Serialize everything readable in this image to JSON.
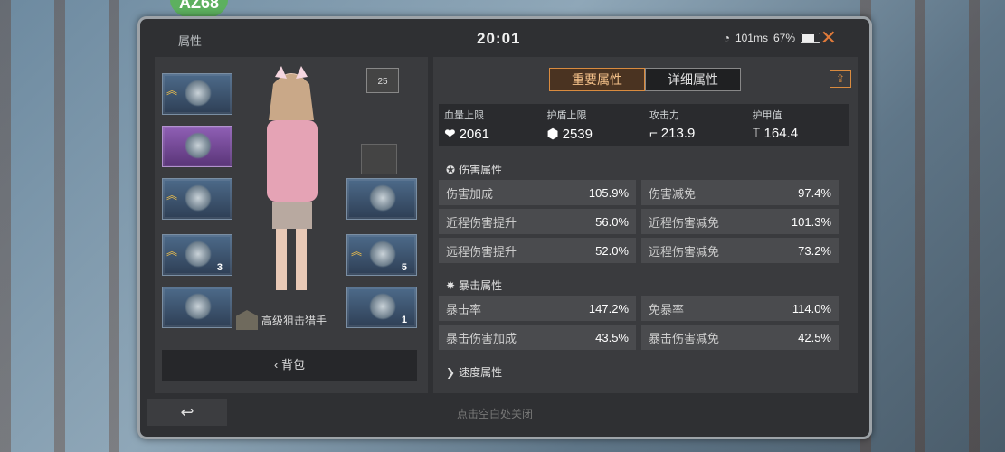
{
  "bubble_text": "AZ68",
  "header": {
    "title": "属性",
    "clock": "20:01",
    "network": "101ms",
    "battery_text": "67%",
    "battery_level": 0.67
  },
  "character": {
    "level": "25",
    "class_label": "高级狙击猎手",
    "backpack_label": "背包",
    "slot_counts": [
      "3",
      "5",
      "1"
    ]
  },
  "tabs": [
    {
      "label": "重要属性"
    },
    {
      "label": "详细属性"
    }
  ],
  "primary": [
    {
      "label": "血量上限",
      "value": "2061"
    },
    {
      "label": "护盾上限",
      "value": "2539"
    },
    {
      "label": "攻击力",
      "value": "213.9"
    },
    {
      "label": "护甲值",
      "value": "164.4"
    }
  ],
  "sections": [
    {
      "title": "伤害属性",
      "cells": [
        {
          "k": "伤害加成",
          "v": "105.9%"
        },
        {
          "k": "伤害减免",
          "v": "97.4%"
        },
        {
          "k": "近程伤害提升",
          "v": "56.0%"
        },
        {
          "k": "近程伤害减免",
          "v": "101.3%"
        },
        {
          "k": "远程伤害提升",
          "v": "52.0%"
        },
        {
          "k": "远程伤害减免",
          "v": "73.2%"
        }
      ]
    },
    {
      "title": "暴击属性",
      "cells": [
        {
          "k": "暴击率",
          "v": "147.2%"
        },
        {
          "k": "免暴率",
          "v": "114.0%"
        },
        {
          "k": "暴击伤害加成",
          "v": "43.5%"
        },
        {
          "k": "暴击伤害减免",
          "v": "42.5%"
        }
      ]
    },
    {
      "title": "速度属性",
      "cells": []
    }
  ],
  "footer": {
    "back_icon": "↩",
    "hint": "点击空白处关闭"
  }
}
